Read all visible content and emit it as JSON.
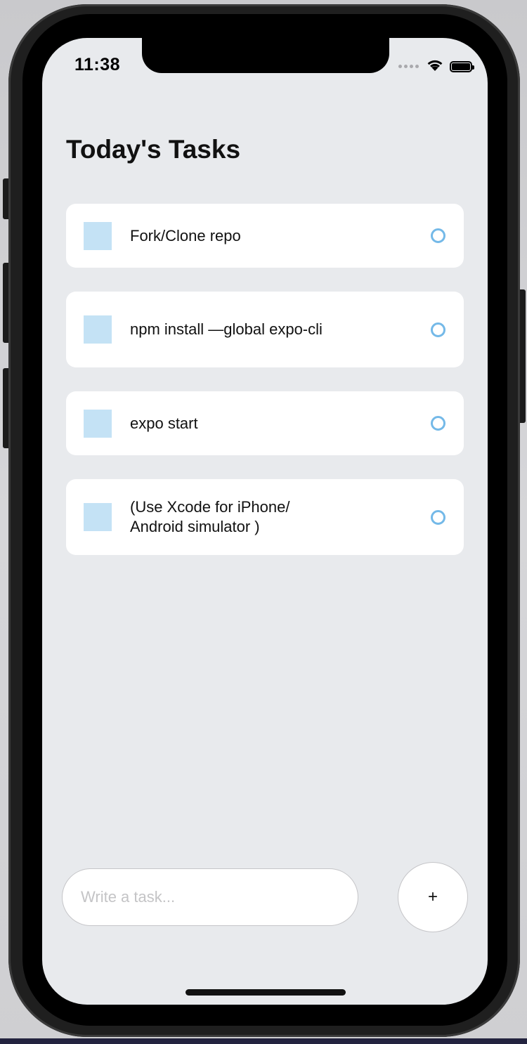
{
  "status_bar": {
    "time": "11:38",
    "signal_icon": "signal-dots-icon",
    "wifi_icon": "wifi-icon",
    "battery_icon": "battery-icon"
  },
  "page": {
    "title": "Today's Tasks"
  },
  "tasks": [
    {
      "text": "Fork/Clone repo"
    },
    {
      "text": "npm install —global expo-cli"
    },
    {
      "text": "expo start"
    },
    {
      "text": "(Use Xcode for iPhone/ Android simulator )"
    }
  ],
  "input": {
    "placeholder": "Write a task...",
    "value": ""
  },
  "add_button": {
    "label": "+"
  },
  "colors": {
    "screen_bg": "#e8eaed",
    "card_bg": "#ffffff",
    "square": "#c4e2f5",
    "circle_border": "#74b9e8",
    "placeholder": "#c4c4c6"
  }
}
